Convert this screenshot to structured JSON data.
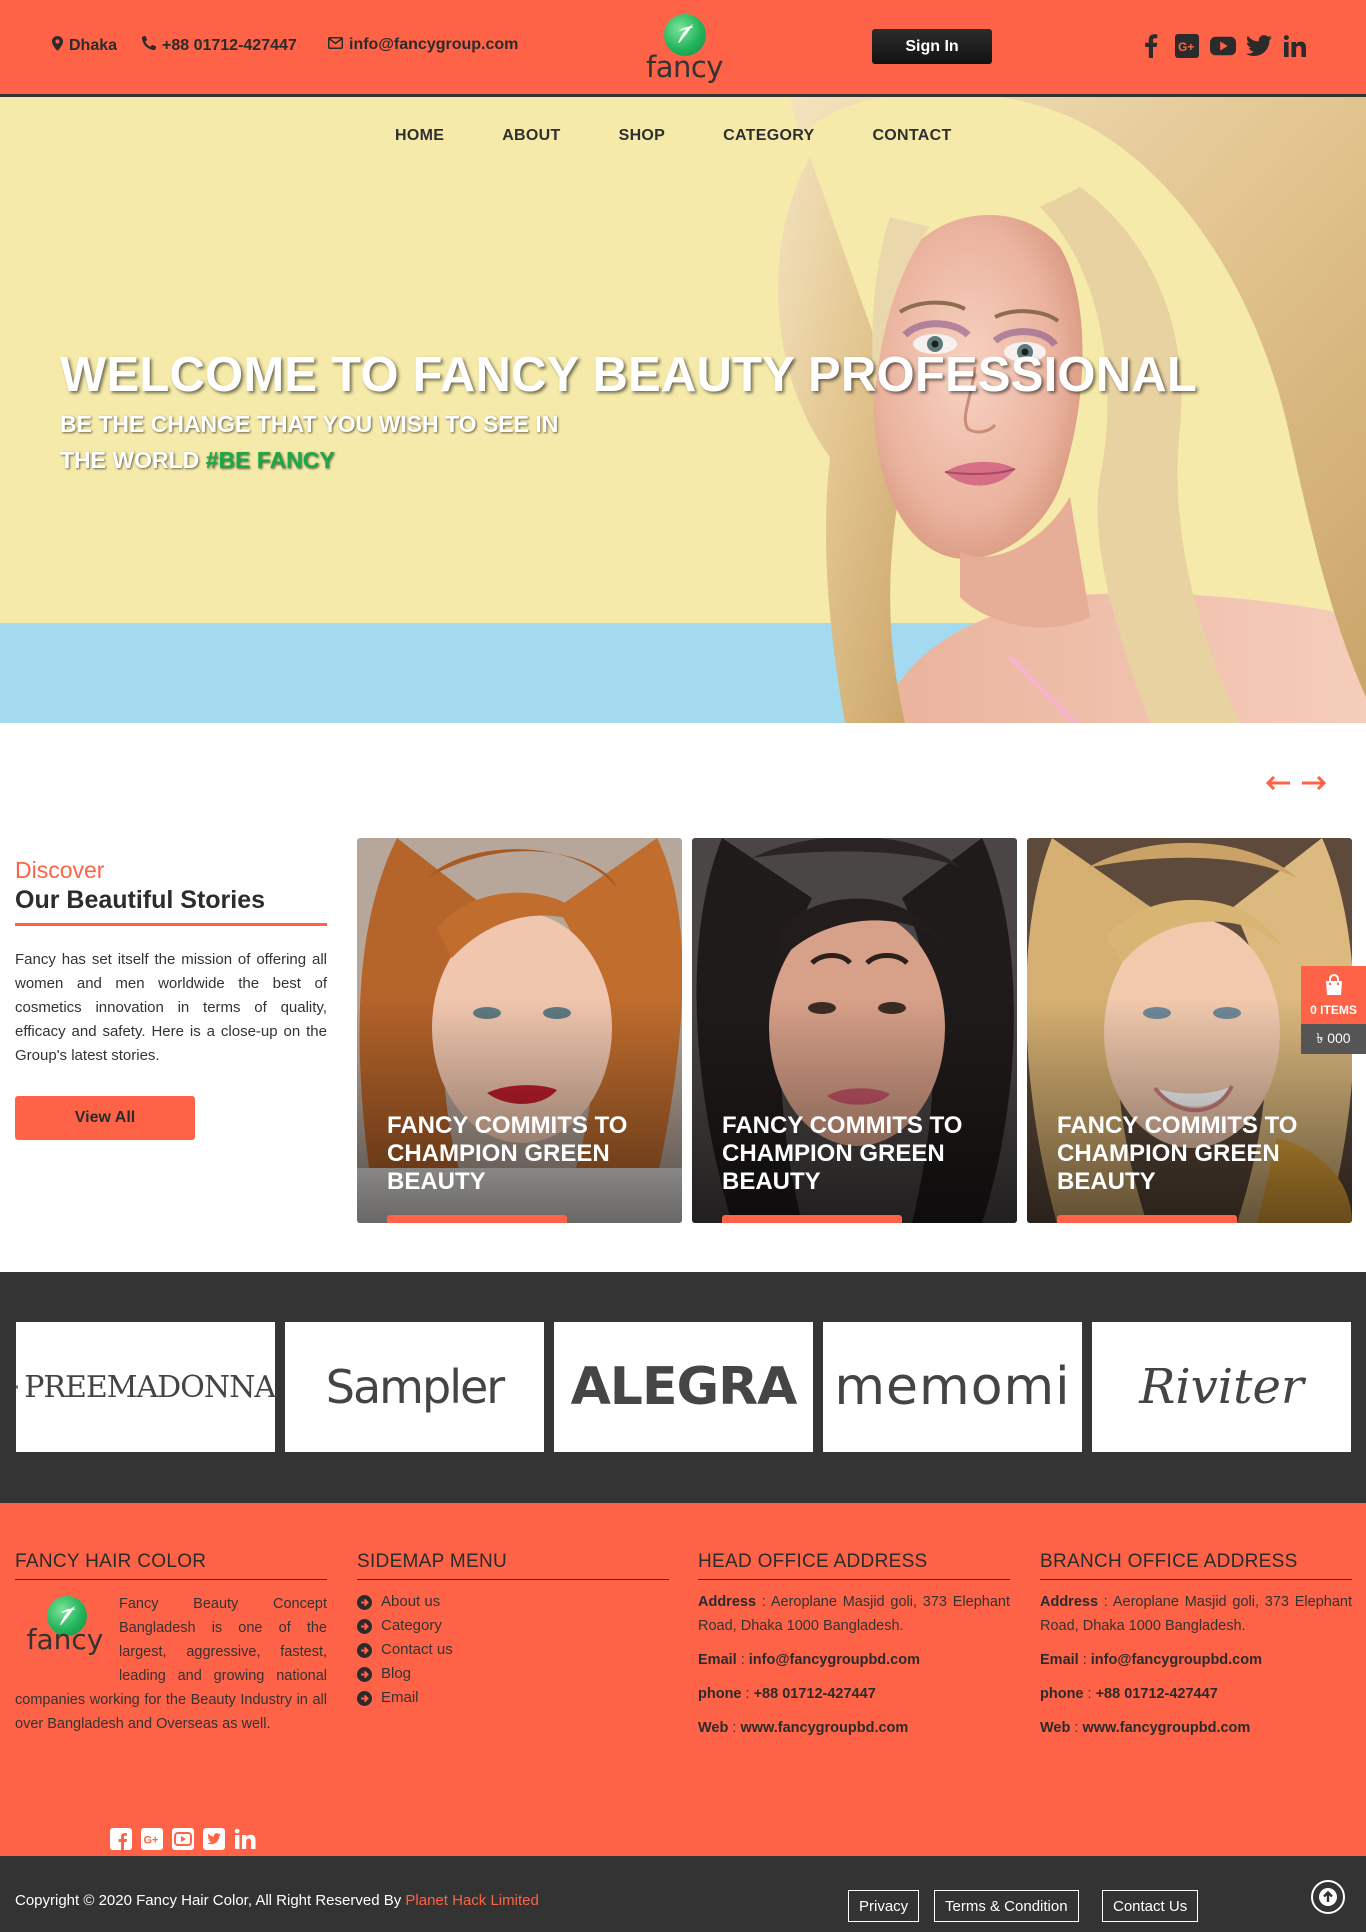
{
  "header": {
    "location": "Dhaka",
    "phone": "+88 01712-427447",
    "email": "info@fancygroup.com",
    "logo_text": "fancy",
    "signin_label": "Sign In",
    "social_icons": [
      "facebook-icon",
      "google-plus-icon",
      "youtube-icon",
      "twitter-icon",
      "linkedin-icon"
    ]
  },
  "nav": [
    "HOME",
    "ABOUT",
    "SHOP",
    "CATEGORY",
    "CONTACT"
  ],
  "hero": {
    "title": "WELCOME TO FANCY BEAUTY PROFESSIONAL",
    "subtitle_line1": "BE THE CHANGE THAT YOU WISH TO SEE IN",
    "subtitle_line2": "THE WORLD",
    "hashtag": "#BE FANCY"
  },
  "stories": {
    "kicker": "Discover",
    "title": "Our Beautiful Stories",
    "description": "Fancy has set itself the mission of offering all women and men worldwide the best of cosmetics innovation in terms of quality, efficacy and safety. Here is a close-up on the Group's latest stories.",
    "view_all_label": "View All",
    "cards": [
      {
        "title": "FANCY COMMITS TO CHAMPION GREEN BEAUTY"
      },
      {
        "title": "FANCY COMMITS TO CHAMPION GREEN BEAUTY"
      },
      {
        "title": "FANCY COMMITS TO CHAMPION GREEN BEAUTY"
      }
    ]
  },
  "cart": {
    "items_label": "0 ITEMS",
    "total": "৳ 000"
  },
  "brands": [
    "PREEMADONNA",
    "Sampler",
    "ALEGRA",
    "memomi",
    "Riviter"
  ],
  "footer": {
    "col1": {
      "heading": "FANCY HAIR COLOR",
      "logo_text": "fancy",
      "text": "Fancy Beauty Concept Bangladesh is one of the largest, aggressive, fastest, leading and growing national companies working for the Beauty Industry in all over Bangladesh and Overseas as well."
    },
    "col2": {
      "heading": "SIDEMAP MENU",
      "items": [
        "About us",
        "Category",
        "Contact us",
        "Blog",
        "Email"
      ]
    },
    "col3": {
      "heading": "HEAD OFFICE ADDRESS",
      "address_label": "Address",
      "address": "Aeroplane Masjid goli, 373 Elephant Road, Dhaka 1000 Bangladesh.",
      "email_label": "Email",
      "email": "info@fancygroupbd.com",
      "phone_label": "phone",
      "phone": "+88 01712-427447",
      "web_label": "Web",
      "web": "www.fancygroupbd.com"
    },
    "col4": {
      "heading": "BRANCH OFFICE ADDRESS",
      "address_label": "Address",
      "address": "Aeroplane Masjid goli, 373 Elephant Road, Dhaka 1000 Bangladesh.",
      "email_label": "Email",
      "email": "info@fancygroupbd.com",
      "phone_label": "phone",
      "phone": "+88 01712-427447",
      "web_label": "Web",
      "web": "www.fancygroupbd.com"
    }
  },
  "bottom": {
    "copyright": "Copyright © 2020 Fancy Hair Color, All Right Reserved By",
    "company": "Planet Hack Limited",
    "links": [
      "Privacy",
      "Terms & Condition",
      "Contact Us"
    ]
  },
  "colors": {
    "accent": "#ff6347",
    "dark": "#333333",
    "hero_bg": "#f5eaa9",
    "hero_sky": "#a3daf0",
    "brand_green": "#1ca943"
  }
}
